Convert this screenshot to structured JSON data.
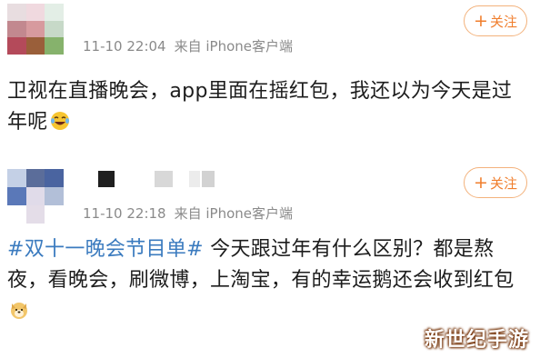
{
  "posts": [
    {
      "time": "11-10 22:04",
      "source": "来自 iPhone客户端",
      "follow_label": "关注",
      "text_before": "卫视在直播晚会，app里面在摇红包，我还以为今天是过年呢",
      "emoji": "laughing-crying-icon"
    },
    {
      "time": "11-10 22:18",
      "source": "来自 iPhone客户端",
      "follow_label": "关注",
      "hashtag": "#双十一晚会节目单#",
      "text_before": " 今天跟过年有什么区别？都是熬夜，看晚会，刷微博，上淘宝，有的幸运鹅还会收到红包",
      "emoji": "dog-face-icon"
    }
  ],
  "watermark": "新世纪手游",
  "colors": {
    "follow": "#f07e2d",
    "hashtag": "#3b7bbf",
    "meta": "#8a8a8a"
  }
}
